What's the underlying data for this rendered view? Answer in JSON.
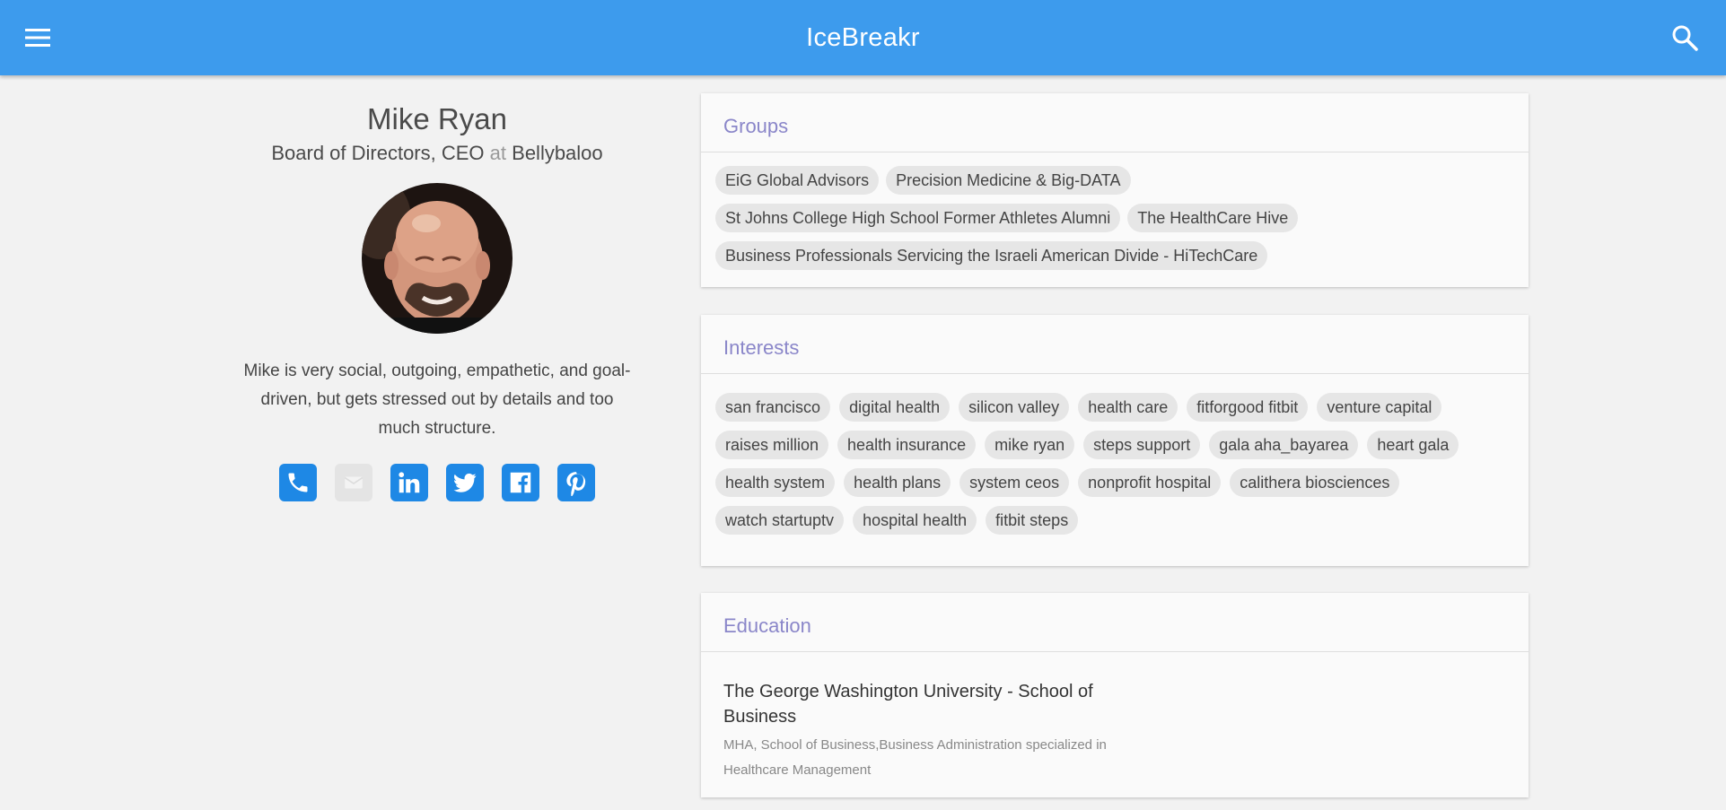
{
  "app": {
    "title": "IceBreakr"
  },
  "profile": {
    "name": "Mike Ryan",
    "role": "Board of Directors, CEO",
    "at_word": "at",
    "company": "Bellybaloo",
    "bio": "Mike is very social, outgoing, empathetic, and goal-driven, but gets stressed out by details and too much structure.",
    "social": [
      {
        "icon": "phone-icon",
        "enabled": true
      },
      {
        "icon": "email-icon",
        "enabled": false
      },
      {
        "icon": "linkedin-icon",
        "enabled": true
      },
      {
        "icon": "twitter-icon",
        "enabled": true
      },
      {
        "icon": "facebook-icon",
        "enabled": true
      },
      {
        "icon": "pinterest-icon",
        "enabled": true
      }
    ]
  },
  "groups": {
    "title": "Groups",
    "items": [
      "EiG Global Advisors",
      "Precision Medicine & Big-DATA",
      "St Johns College High School Former Athletes Alumni",
      "The HealthCare Hive",
      "Business Professionals Servicing the Israeli American Divide - HiTechCare"
    ]
  },
  "interests": {
    "title": "Interests",
    "items": [
      "san francisco",
      "digital health",
      "silicon valley",
      "health care",
      "fitforgood fitbit",
      "venture capital",
      "raises million",
      "health insurance",
      "mike ryan",
      "steps support",
      "gala aha_bayarea",
      "heart gala",
      "health system",
      "health plans",
      "system ceos",
      "nonprofit hospital",
      "calithera biosciences",
      "watch startuptv",
      "hospital health",
      "fitbit steps"
    ]
  },
  "education": {
    "title": "Education",
    "school": "The George Washington University - School of Business",
    "degree": "MHA, School of Business,Business Administration specialized in Healthcare Management"
  },
  "colors": {
    "appbar": "#3d9bed",
    "social": "#1e88e5",
    "section_title": "#8a86c9"
  }
}
